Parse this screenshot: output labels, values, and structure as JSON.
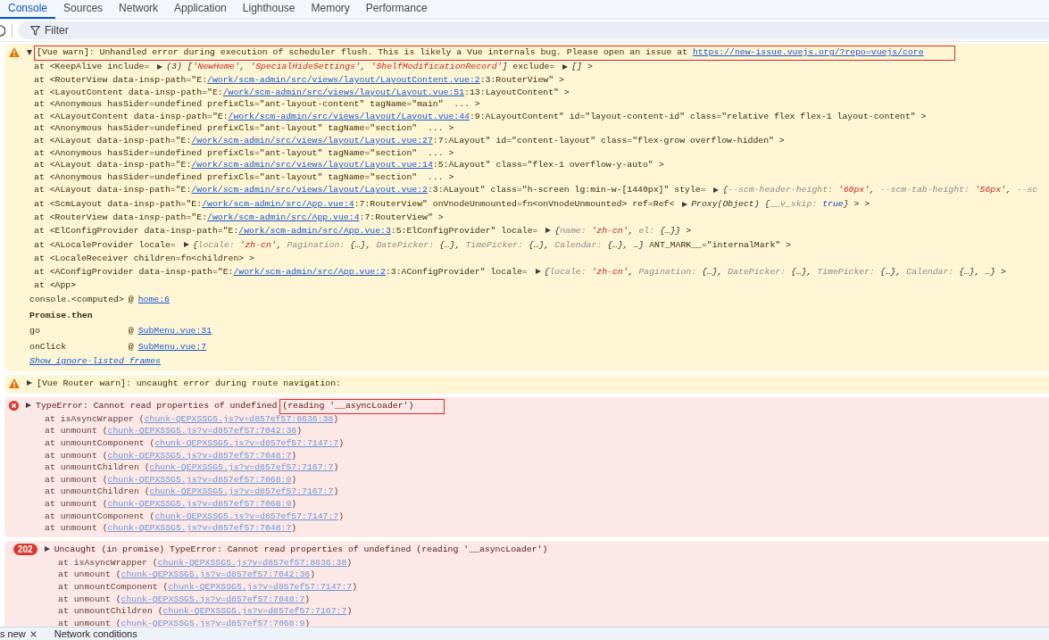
{
  "tabs": [
    {
      "label": "Console",
      "selected": true
    },
    {
      "label": "Sources",
      "selected": false
    },
    {
      "label": "Network",
      "selected": false
    },
    {
      "label": "Application",
      "selected": false
    },
    {
      "label": "Lighthouse",
      "selected": false
    },
    {
      "label": "Memory",
      "selected": false
    },
    {
      "label": "Performance",
      "selected": false
    }
  ],
  "filter": {
    "placeholder": "Filter"
  },
  "messages": [
    {
      "kind": "warning",
      "expanded": true,
      "header": [
        {
          "kind": "text",
          "text": "[Vue warn]: Unhandled error during execution of scheduler flush. This is likely a Vue internals bug. Please open an issue at ",
          "annotated": true
        },
        {
          "kind": "link",
          "text": "https://new-issue.vuejs.org/?repo=vuejs/core",
          "annotated": true
        }
      ],
      "lines": [
        [
          {
            "kind": "text",
            "text": "at <KeepAlive include= "
          },
          {
            "kind": "toggle",
            "expanded": false
          },
          {
            "kind": "preview",
            "text": "(3) ["
          },
          {
            "kind": "string",
            "text": "'NewHome'"
          },
          {
            "kind": "preview",
            "text": ", "
          },
          {
            "kind": "string",
            "text": "'SpecialHideSettings'"
          },
          {
            "kind": "preview",
            "text": ", "
          },
          {
            "kind": "string",
            "text": "'ShelfModificationRecord'"
          },
          {
            "kind": "preview",
            "text": "]"
          },
          {
            "kind": "text",
            "text": " exclude= "
          },
          {
            "kind": "toggle",
            "expanded": false
          },
          {
            "kind": "preview",
            "text": "[]"
          },
          {
            "kind": "text",
            "text": " >"
          }
        ],
        [
          {
            "kind": "text",
            "text": "at <RouterView data-insp-path=\"E:"
          },
          {
            "kind": "link",
            "text": "/work/scm-admin/src/views/layout/LayoutContent.vue:2"
          },
          {
            "kind": "text",
            "text": ":3:RouterView\" >"
          }
        ],
        [
          {
            "kind": "text",
            "text": "at <LayoutContent data-insp-path=\"E:"
          },
          {
            "kind": "link",
            "text": "/work/scm-admin/src/views/layout/Layout.vue:51"
          },
          {
            "kind": "text",
            "text": ":13:LayoutContent\" >"
          }
        ],
        [
          {
            "kind": "text",
            "text": "at <Anonymous hasSider=undefined prefixCls=\"ant-layout-content\" tagName=\"main\"  ... >"
          }
        ],
        [
          {
            "kind": "text",
            "text": "at <ALayoutContent data-insp-path=\"E:"
          },
          {
            "kind": "link",
            "text": "/work/scm-admin/src/views/layout/Layout.vue:44"
          },
          {
            "kind": "text",
            "text": ":9:ALayoutContent\" id=\"layout-content-id\" class=\"relative flex flex-1 layout-content\" >"
          }
        ],
        [
          {
            "kind": "text",
            "text": "at <Anonymous hasSider=undefined prefixCls=\"ant-layout\" tagName=\"section\"  ... >"
          }
        ],
        [
          {
            "kind": "text",
            "text": "at <ALayout data-insp-path=\"E:"
          },
          {
            "kind": "link",
            "text": "/work/scm-admin/src/views/layout/Layout.vue:27"
          },
          {
            "kind": "text",
            "text": ":7:ALayout\" id=\"content-layout\" class=\"flex-grow overflow-hidden\" >"
          }
        ],
        [
          {
            "kind": "text",
            "text": "at <Anonymous hasSider=undefined prefixCls=\"ant-layout\" tagName=\"section\"  ... >"
          }
        ],
        [
          {
            "kind": "text",
            "text": "at <ALayout data-insp-path=\"E:"
          },
          {
            "kind": "link",
            "text": "/work/scm-admin/src/views/layout/Layout.vue:14"
          },
          {
            "kind": "text",
            "text": ":5:ALayout\" class=\"flex-1 overflow-y-auto\" >"
          }
        ],
        [
          {
            "kind": "text",
            "text": "at <Anonymous hasSider=undefined prefixCls=\"ant-layout\" tagName=\"section\"  ... >"
          }
        ],
        [
          {
            "kind": "text",
            "text": "at <ALayout data-insp-path=\"E:"
          },
          {
            "kind": "link",
            "text": "/work/scm-admin/src/views/layout/Layout.vue:2"
          },
          {
            "kind": "text",
            "text": ":3:ALayout\" class=\"h-screen lg:min-w-[1440px]\" style= "
          },
          {
            "kind": "toggle",
            "expanded": false
          },
          {
            "kind": "preview",
            "text": "{"
          },
          {
            "kind": "key",
            "text": "--scm-header-height: "
          },
          {
            "kind": "string",
            "text": "'60px'"
          },
          {
            "kind": "preview",
            "text": ", "
          },
          {
            "kind": "key",
            "text": "--scm-tab-height: "
          },
          {
            "kind": "string",
            "text": "'56px'"
          },
          {
            "kind": "preview",
            "text": ", "
          },
          {
            "kind": "key",
            "text": "--sc"
          }
        ],
        [
          {
            "kind": "text",
            "text": "at <ScmLayout data-insp-path=\"E:"
          },
          {
            "kind": "link",
            "text": "/work/scm-admin/src/App.vue:4"
          },
          {
            "kind": "text",
            "text": ":7:RouterView\" onVnodeUnmounted=fn<onVnodeUnmounted> ref=Ref< "
          },
          {
            "kind": "toggle",
            "expanded": false
          },
          {
            "kind": "preview",
            "text": "Proxy(Object) {"
          },
          {
            "kind": "key",
            "text": "__v_skip: "
          },
          {
            "kind": "keyword",
            "text": "true"
          },
          {
            "kind": "preview",
            "text": "}"
          },
          {
            "kind": "text",
            "text": " > >"
          }
        ],
        [
          {
            "kind": "text",
            "text": "at <RouterView data-insp-path=\"E:"
          },
          {
            "kind": "link",
            "text": "/work/scm-admin/src/App.vue:4"
          },
          {
            "kind": "text",
            "text": ":7:RouterView\" >"
          }
        ],
        [
          {
            "kind": "text",
            "text": "at <ElConfigProvider data-insp-path=\"E:"
          },
          {
            "kind": "link",
            "text": "/work/scm-admin/src/App.vue:3"
          },
          {
            "kind": "text",
            "text": ":5:ElConfigProvider\" locale= "
          },
          {
            "kind": "toggle",
            "expanded": false
          },
          {
            "kind": "preview",
            "text": "{"
          },
          {
            "kind": "key",
            "text": "name: "
          },
          {
            "kind": "string",
            "text": "'zh-cn'"
          },
          {
            "kind": "preview",
            "text": ", "
          },
          {
            "kind": "key",
            "text": "el:"
          },
          {
            "kind": "preview",
            "text": " {…}}"
          },
          {
            "kind": "text",
            "text": " >"
          }
        ],
        [
          {
            "kind": "text",
            "text": "at <ALocaleProvider locale= "
          },
          {
            "kind": "toggle",
            "expanded": false
          },
          {
            "kind": "preview",
            "text": "{"
          },
          {
            "kind": "key",
            "text": "locale: "
          },
          {
            "kind": "string",
            "text": "'zh-cn'"
          },
          {
            "kind": "preview",
            "text": ", "
          },
          {
            "kind": "key",
            "text": "Pagination:"
          },
          {
            "kind": "preview",
            "text": " {…}, "
          },
          {
            "kind": "key",
            "text": "DatePicker:"
          },
          {
            "kind": "preview",
            "text": " {…}, "
          },
          {
            "kind": "key",
            "text": "TimePicker:"
          },
          {
            "kind": "preview",
            "text": " {…}, "
          },
          {
            "kind": "key",
            "text": "Calendar:"
          },
          {
            "kind": "preview",
            "text": " {…}, …}"
          },
          {
            "kind": "text",
            "text": " ANT_MARK__=\"internalMark\" >"
          }
        ],
        [
          {
            "kind": "text",
            "text": "at <LocaleReceiver children=fn<children> >"
          }
        ],
        [
          {
            "kind": "text",
            "text": "at <AConfigProvider data-insp-path=\"E:"
          },
          {
            "kind": "link",
            "text": "/work/scm-admin/src/App.vue:2"
          },
          {
            "kind": "text",
            "text": ":3:AConfigProvider\" locale= "
          },
          {
            "kind": "toggle",
            "expanded": false
          },
          {
            "kind": "preview",
            "text": "{"
          },
          {
            "kind": "key",
            "text": "locale: "
          },
          {
            "kind": "string",
            "text": "'zh-cn'"
          },
          {
            "kind": "preview",
            "text": ", "
          },
          {
            "kind": "key",
            "text": "Pagination:"
          },
          {
            "kind": "preview",
            "text": " {…}, "
          },
          {
            "kind": "key",
            "text": "DatePicker:"
          },
          {
            "kind": "preview",
            "text": " {…}, "
          },
          {
            "kind": "key",
            "text": "TimePicker:"
          },
          {
            "kind": "preview",
            "text": " {…}, "
          },
          {
            "kind": "key",
            "text": "Calendar:"
          },
          {
            "kind": "preview",
            "text": " {…}, …}"
          },
          {
            "kind": "text",
            "text": " >"
          }
        ],
        [
          {
            "kind": "text",
            "text": "at <App>"
          }
        ]
      ],
      "call_stack": [
        {
          "kind": "frame",
          "function": "console.<computed>",
          "separator": "@",
          "source": "home:6"
        },
        {
          "kind": "async",
          "label": "Promise.then"
        },
        {
          "kind": "frame",
          "function": "go",
          "separator": "@",
          "source": "SubMenu.vue:31"
        },
        {
          "kind": "frame",
          "function": "onClick",
          "separator": "@",
          "source": "SubMenu.vue:7"
        }
      ],
      "show_more_link": "Show ignore-listed frames"
    },
    {
      "kind": "warning",
      "expanded": false,
      "header": [
        {
          "kind": "text",
          "text": "[Vue Router warn]: uncaught error during route navigation:",
          "annotated": false
        }
      ]
    },
    {
      "kind": "error",
      "expanded": false,
      "header": [
        {
          "kind": "text",
          "text": "TypeError: Cannot read properties of undefined ",
          "annotated": false
        },
        {
          "kind": "text",
          "text": "(reading '__asyncLoader')",
          "annotated": true
        }
      ],
      "lines": [
        [
          {
            "kind": "text",
            "text": "at isAsyncWrapper ("
          },
          {
            "kind": "link",
            "text": "chunk-QEPXSSG5.js?v=d857ef57:8636:38"
          },
          {
            "kind": "text",
            "text": ")"
          }
        ],
        [
          {
            "kind": "text",
            "text": "at unmount ("
          },
          {
            "kind": "link",
            "text": "chunk-QEPXSSG5.js?v=d857ef57:7042:36"
          },
          {
            "kind": "text",
            "text": ")"
          }
        ],
        [
          {
            "kind": "text",
            "text": "at unmountComponent ("
          },
          {
            "kind": "link",
            "text": "chunk-QEPXSSG5.js?v=d857ef57:7147:7"
          },
          {
            "kind": "text",
            "text": ")"
          }
        ],
        [
          {
            "kind": "text",
            "text": "at unmount ("
          },
          {
            "kind": "link",
            "text": "chunk-QEPXSSG5.js?v=d857ef57:7048:7"
          },
          {
            "kind": "text",
            "text": ")"
          }
        ],
        [
          {
            "kind": "text",
            "text": "at unmountChildren ("
          },
          {
            "kind": "link",
            "text": "chunk-QEPXSSG5.js?v=d857ef57:7167:7"
          },
          {
            "kind": "text",
            "text": ")"
          }
        ],
        [
          {
            "kind": "text",
            "text": "at unmount ("
          },
          {
            "kind": "link",
            "text": "chunk-QEPXSSG5.js?v=d857ef57:7068:9"
          },
          {
            "kind": "text",
            "text": ")"
          }
        ],
        [
          {
            "kind": "text",
            "text": "at unmountChildren ("
          },
          {
            "kind": "link",
            "text": "chunk-QEPXSSG5.js?v=d857ef57:7167:7"
          },
          {
            "kind": "text",
            "text": ")"
          }
        ],
        [
          {
            "kind": "text",
            "text": "at unmount ("
          },
          {
            "kind": "link",
            "text": "chunk-QEPXSSG5.js?v=d857ef57:7068:9"
          },
          {
            "kind": "text",
            "text": ")"
          }
        ],
        [
          {
            "kind": "text",
            "text": "at unmountComponent ("
          },
          {
            "kind": "link",
            "text": "chunk-QEPXSSG5.js?v=d857ef57:7147:7"
          },
          {
            "kind": "text",
            "text": ")"
          }
        ],
        [
          {
            "kind": "text",
            "text": "at unmount ("
          },
          {
            "kind": "link",
            "text": "chunk-QEPXSSG5.js?v=d857ef57:7048:7"
          },
          {
            "kind": "text",
            "text": ")"
          }
        ]
      ]
    },
    {
      "kind": "error",
      "count": "202",
      "expanded": false,
      "header": [
        {
          "kind": "text",
          "text": "Uncaught (in promise) TypeError: Cannot read properties of undefined (reading '__asyncLoader')",
          "annotated": false
        }
      ],
      "lines": [
        [
          {
            "kind": "text",
            "text": "at isAsyncWrapper ("
          },
          {
            "kind": "link",
            "text": "chunk-QEPXSSG5.js?v=d857ef57:8636:38"
          },
          {
            "kind": "text",
            "text": ")"
          }
        ],
        [
          {
            "kind": "text",
            "text": "at unmount ("
          },
          {
            "kind": "link",
            "text": "chunk-QEPXSSG5.js?v=d857ef57:7042:36"
          },
          {
            "kind": "text",
            "text": ")"
          }
        ],
        [
          {
            "kind": "text",
            "text": "at unmountComponent ("
          },
          {
            "kind": "link",
            "text": "chunk-QEPXSSG5.js?v=d857ef57:7147:7"
          },
          {
            "kind": "text",
            "text": ")"
          }
        ],
        [
          {
            "kind": "text",
            "text": "at unmount ("
          },
          {
            "kind": "link",
            "text": "chunk-QEPXSSG5.js?v=d857ef57:7048:7"
          },
          {
            "kind": "text",
            "text": ")"
          }
        ],
        [
          {
            "kind": "text",
            "text": "at unmountChildren ("
          },
          {
            "kind": "link",
            "text": "chunk-QEPXSSG5.js?v=d857ef57:7167:7"
          },
          {
            "kind": "text",
            "text": ")"
          }
        ],
        [
          {
            "kind": "text",
            "text": "at unmount ("
          },
          {
            "kind": "link",
            "text": "chunk-QEPXSSG5.js?v=d857ef57:7068:9"
          },
          {
            "kind": "text",
            "text": ")"
          }
        ]
      ]
    }
  ],
  "drawer_tabs": [
    {
      "label": "s new",
      "closable": true
    },
    {
      "label": "Network conditions",
      "closable": false
    }
  ]
}
